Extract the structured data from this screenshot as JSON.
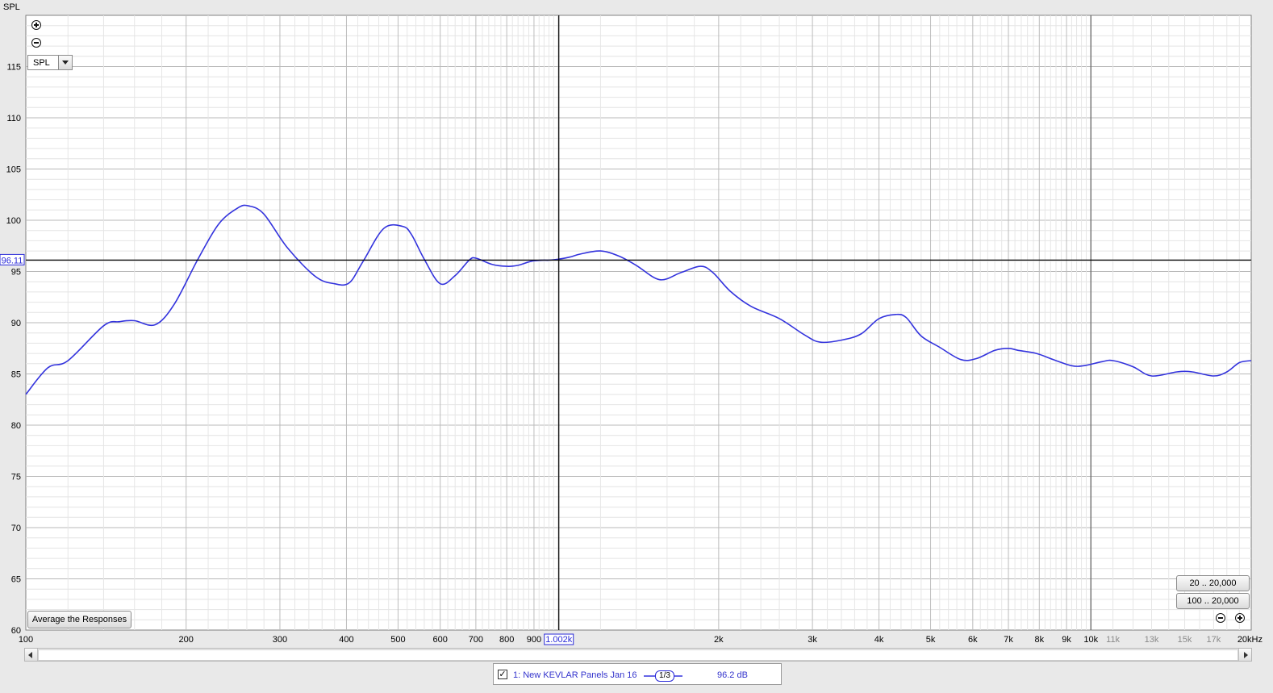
{
  "chart_data": {
    "type": "line",
    "ylabel": "SPL",
    "xunit": "kHz",
    "x_scale": "log",
    "xlim": [
      100,
      20000
    ],
    "ylim": [
      60,
      120
    ],
    "y_ticks": [
      60,
      65,
      70,
      75,
      80,
      85,
      90,
      95,
      100,
      105,
      110,
      115
    ],
    "x_ticks": [
      {
        "value": 100,
        "label": "100",
        "major": true
      },
      {
        "value": 200,
        "label": "200",
        "major": true
      },
      {
        "value": 300,
        "label": "300",
        "major": true
      },
      {
        "value": 400,
        "label": "400",
        "major": true
      },
      {
        "value": 500,
        "label": "500",
        "major": true
      },
      {
        "value": 600,
        "label": "600",
        "major": true
      },
      {
        "value": 700,
        "label": "700",
        "major": true
      },
      {
        "value": 800,
        "label": "800",
        "major": true
      },
      {
        "value": 900,
        "label": "900",
        "major": true
      },
      {
        "value": 2000,
        "label": "2k",
        "major": true
      },
      {
        "value": 3000,
        "label": "3k",
        "major": true
      },
      {
        "value": 4000,
        "label": "4k",
        "major": true
      },
      {
        "value": 5000,
        "label": "5k",
        "major": true
      },
      {
        "value": 6000,
        "label": "6k",
        "major": true
      },
      {
        "value": 7000,
        "label": "7k",
        "major": true
      },
      {
        "value": 8000,
        "label": "8k",
        "major": true
      },
      {
        "value": 9000,
        "label": "9k",
        "major": true
      },
      {
        "value": 10000,
        "label": "10k",
        "major": true
      },
      {
        "value": 11000,
        "label": "11k",
        "major": false
      },
      {
        "value": 13000,
        "label": "13k",
        "major": false
      },
      {
        "value": 15000,
        "label": "15k",
        "major": false
      },
      {
        "value": 17000,
        "label": "17k",
        "major": false
      },
      {
        "value": 20000,
        "label": "20kHz",
        "major": true
      }
    ],
    "grid": true,
    "cursor": {
      "x": 1002,
      "x_label": "1.002k",
      "y": 96.11,
      "y_label": "96.11"
    },
    "series": [
      {
        "name": "1: New KEVLAR Panels Jan 16",
        "color": "#3333dd",
        "x": [
          100,
          110,
          120,
          140,
          150,
          160,
          175,
          190,
          210,
          230,
          250,
          262,
          280,
          310,
          350,
          380,
          405,
          430,
          470,
          510,
          530,
          560,
          600,
          640,
          680,
          700,
          750,
          800,
          840,
          890,
          935,
          960,
          1000,
          1050,
          1100,
          1200,
          1300,
          1400,
          1550,
          1700,
          1850,
          1950,
          2100,
          2300,
          2600,
          2900,
          3100,
          3400,
          3700,
          4000,
          4300,
          4500,
          4800,
          5200,
          5700,
          6100,
          6600,
          7000,
          7300,
          7900,
          8500,
          9200,
          9700,
          10500,
          11000,
          12000,
          13000,
          14500,
          15500,
          17000,
          18000,
          19000,
          20000
        ],
        "values": [
          83.0,
          85.6,
          86.3,
          89.7,
          90.1,
          90.2,
          89.8,
          91.8,
          96.1,
          99.6,
          101.2,
          101.4,
          100.6,
          97.3,
          94.5,
          93.8,
          93.9,
          96.0,
          99.2,
          99.4,
          98.6,
          96.2,
          93.8,
          94.6,
          96.1,
          96.3,
          95.7,
          95.5,
          95.6,
          96.0,
          96.1,
          96.1,
          96.2,
          96.4,
          96.7,
          97.0,
          96.5,
          95.6,
          94.2,
          94.9,
          95.5,
          94.9,
          93.1,
          91.6,
          90.4,
          88.8,
          88.1,
          88.3,
          88.9,
          90.4,
          90.8,
          90.5,
          88.7,
          87.6,
          86.4,
          86.5,
          87.3,
          87.5,
          87.3,
          87.0,
          86.4,
          85.8,
          85.8,
          86.2,
          86.3,
          85.7,
          84.8,
          85.2,
          85.2,
          84.8,
          85.2,
          86.1,
          86.3
        ]
      }
    ]
  },
  "controls": {
    "dropdown_value": "SPL",
    "average_button": "Average the Responses",
    "range_button_1": "20 .. 20,000",
    "range_button_2": "100 .. 20,000"
  },
  "legend": {
    "checked": "✓",
    "name": "1: New KEVLAR Panels Jan 16",
    "smoothing": "1/3",
    "value": "96.2 dB"
  }
}
